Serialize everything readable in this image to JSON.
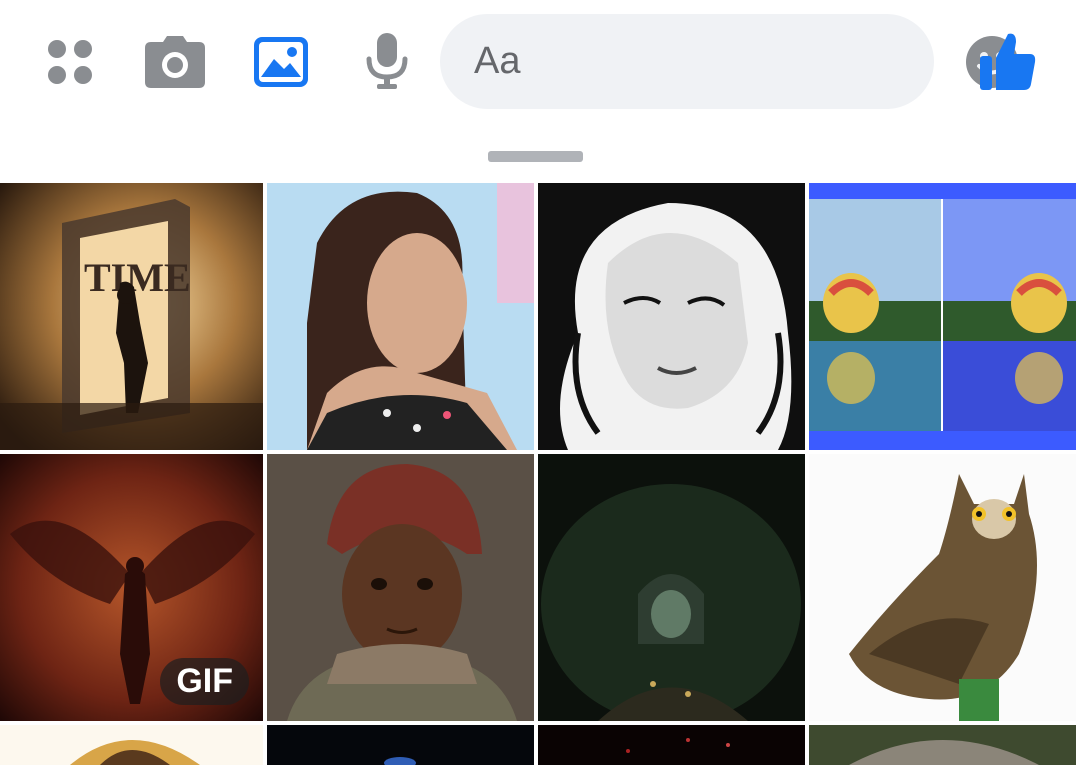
{
  "toolbar": {
    "items": [
      {
        "name": "menu-icon"
      },
      {
        "name": "camera-icon"
      },
      {
        "name": "gallery-icon"
      },
      {
        "name": "microphone-icon"
      }
    ],
    "composer": {
      "placeholder": "Aa",
      "emoji_icon": "emoji-icon"
    },
    "like_icon": "thumbs-up-icon",
    "colors": {
      "accent": "#1877f2",
      "inactive": "#8a8d91",
      "composer_bg": "#f0f2f5"
    }
  },
  "gallery": {
    "tiles": [
      {
        "name": "photo-time-door",
        "badge": "",
        "text": "TIME"
      },
      {
        "name": "photo-woman-portrait",
        "badge": ""
      },
      {
        "name": "photo-bw-woman",
        "badge": ""
      },
      {
        "name": "photo-balloons-compare",
        "badge": ""
      },
      {
        "name": "photo-fiery-angel",
        "badge": "GIF"
      },
      {
        "name": "photo-child-portrait",
        "badge": ""
      },
      {
        "name": "photo-forest-tunnel",
        "badge": ""
      },
      {
        "name": "photo-owl",
        "badge": ""
      }
    ]
  }
}
